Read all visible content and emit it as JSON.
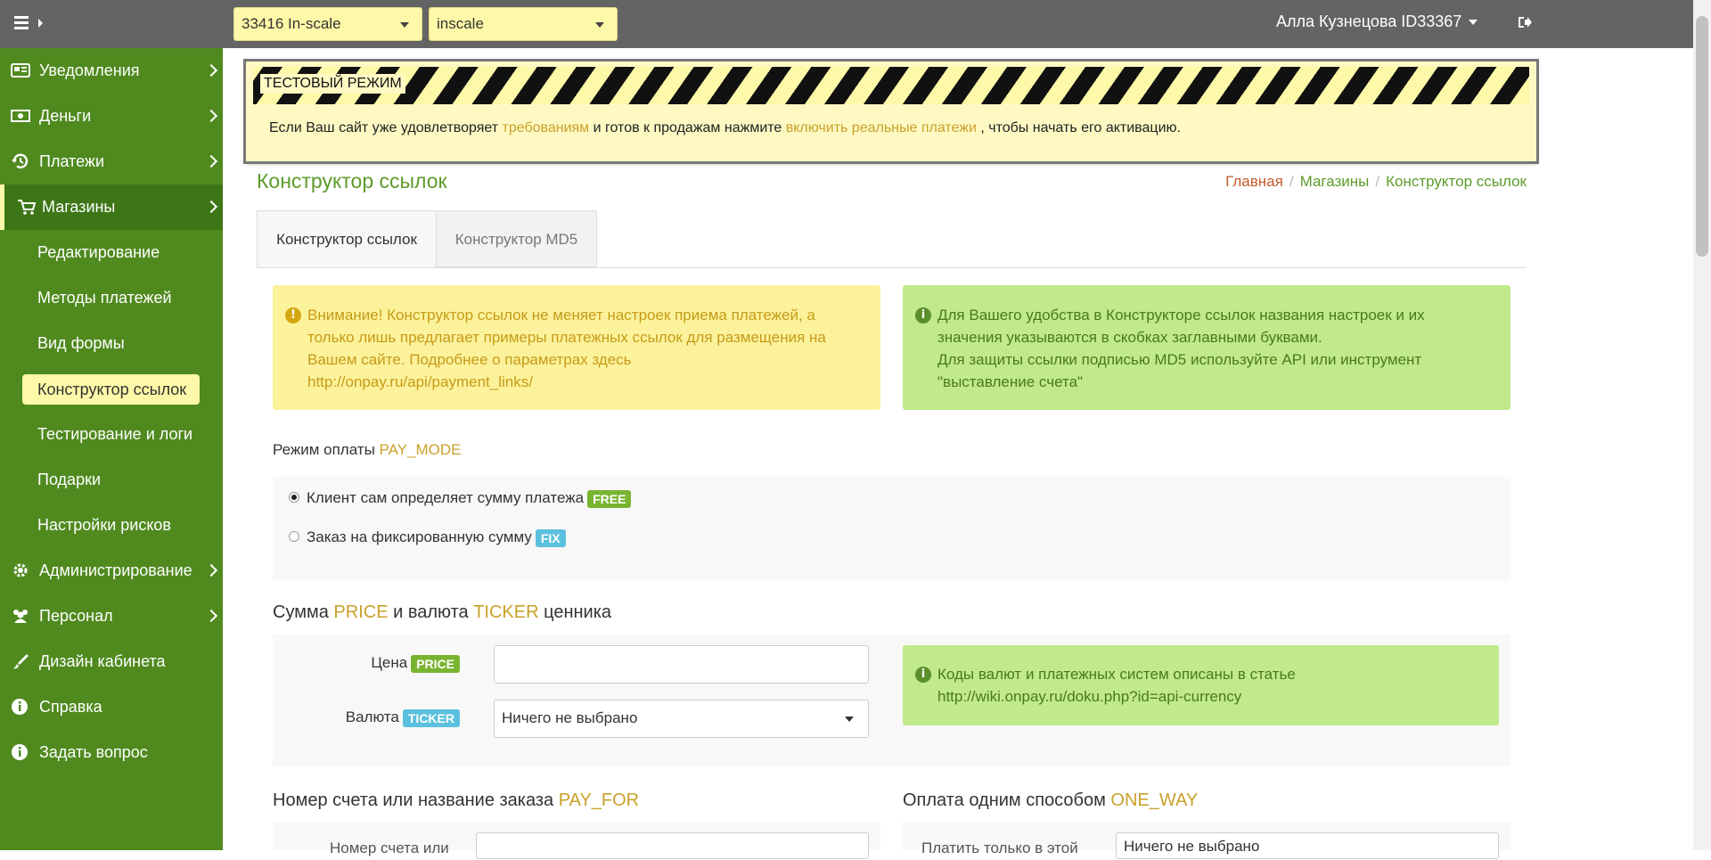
{
  "topbar": {
    "shop_select": "33416 In-scale",
    "shop_name_select": "inscale",
    "user": "Алла Кузнецова ID33367"
  },
  "sidebar": {
    "items": [
      {
        "label": "Уведомления",
        "icon": "newspaper-icon"
      },
      {
        "label": "Деньги",
        "icon": "money-icon"
      },
      {
        "label": "Платежи",
        "icon": "history-icon"
      },
      {
        "label": "Магазины",
        "icon": "cart-icon"
      },
      {
        "label": "Администрирование",
        "icon": "gear-icon"
      },
      {
        "label": "Персонал",
        "icon": "users-icon"
      },
      {
        "label": "Дизайн кабинета",
        "icon": "brush-icon"
      },
      {
        "label": "Справка",
        "icon": "info-icon"
      },
      {
        "label": "Задать вопрос",
        "icon": "info-icon"
      }
    ],
    "sub_items": [
      {
        "label": "Редактирование"
      },
      {
        "label": "Методы платежей"
      },
      {
        "label": "Вид формы"
      },
      {
        "label": "Конструктор ссылок"
      },
      {
        "label": "Тестирование и логи"
      },
      {
        "label": "Подарки"
      },
      {
        "label": "Настройки рисков"
      }
    ]
  },
  "test_banner": {
    "tag": "ТЕСТОВЫЙ РЕЖИМ",
    "text_1": "Если Ваш сайт уже удовлетворяет ",
    "link_1": "требованиям",
    "text_2": " и готов к продажам нажмите ",
    "link_2": "включить реальные платежи",
    "text_3": " , чтобы начать его активацию."
  },
  "page": {
    "title": "Конструктор ссылок",
    "breadcrumb": {
      "home": "Главная",
      "middle": "Магазины",
      "current": "Конструктор ссылок"
    },
    "tabs": [
      {
        "label": "Конструктор ссылок"
      },
      {
        "label": "Конструктор MD5"
      }
    ]
  },
  "alerts": {
    "warning_lines": [
      "Внимание! Конструктор ссылок не меняет настроек приема платежей, а",
      "только лишь предлагает примеры платежных ссылок для размещения на",
      "Вашем сайте. Подробнее о параметрах здесь",
      "http://onpay.ru/api/payment_links/"
    ],
    "info_lines": [
      "Для Вашего удобства в Конструкторе ссылок названия настроек и их",
      "значения указываются в скобках заглавными буквами.",
      "Для защиты ссылки подписью MD5 используйте API или инструмент",
      "\"выставление счета\""
    ],
    "currency_lines": [
      "Коды валют и платежных систем описаны в статье",
      "http://wiki.onpay.ru/doku.php?id=api-currency"
    ]
  },
  "pay_mode": {
    "label": "Режим оплаты ",
    "param": "PAY_MODE",
    "options": [
      {
        "label": "Клиент сам определяет сумму платежа",
        "badge": "FREE"
      },
      {
        "label": "Заказ на фиксированную сумму",
        "badge": "FIX"
      }
    ]
  },
  "price_section": {
    "head_1": "Сумма ",
    "param_1": "PRICE",
    "head_2": " и валюта ",
    "param_2": "TICKER",
    "head_3": " ценника",
    "price_label": "Цена",
    "price_badge": "PRICE",
    "price_value": "",
    "currency_label": "Валюта",
    "currency_badge": "TICKER",
    "currency_value": "Ничего не выбрано"
  },
  "pay_for": {
    "head": "Номер счета или название заказа ",
    "param": "PAY_FOR",
    "field_label_cut": "Номер счета или"
  },
  "one_way": {
    "head": "Оплата одним способом ",
    "param": "ONE_WAY",
    "field_label_cut": "Платить только в этой",
    "select_cut": "Ничего не выбрано"
  }
}
